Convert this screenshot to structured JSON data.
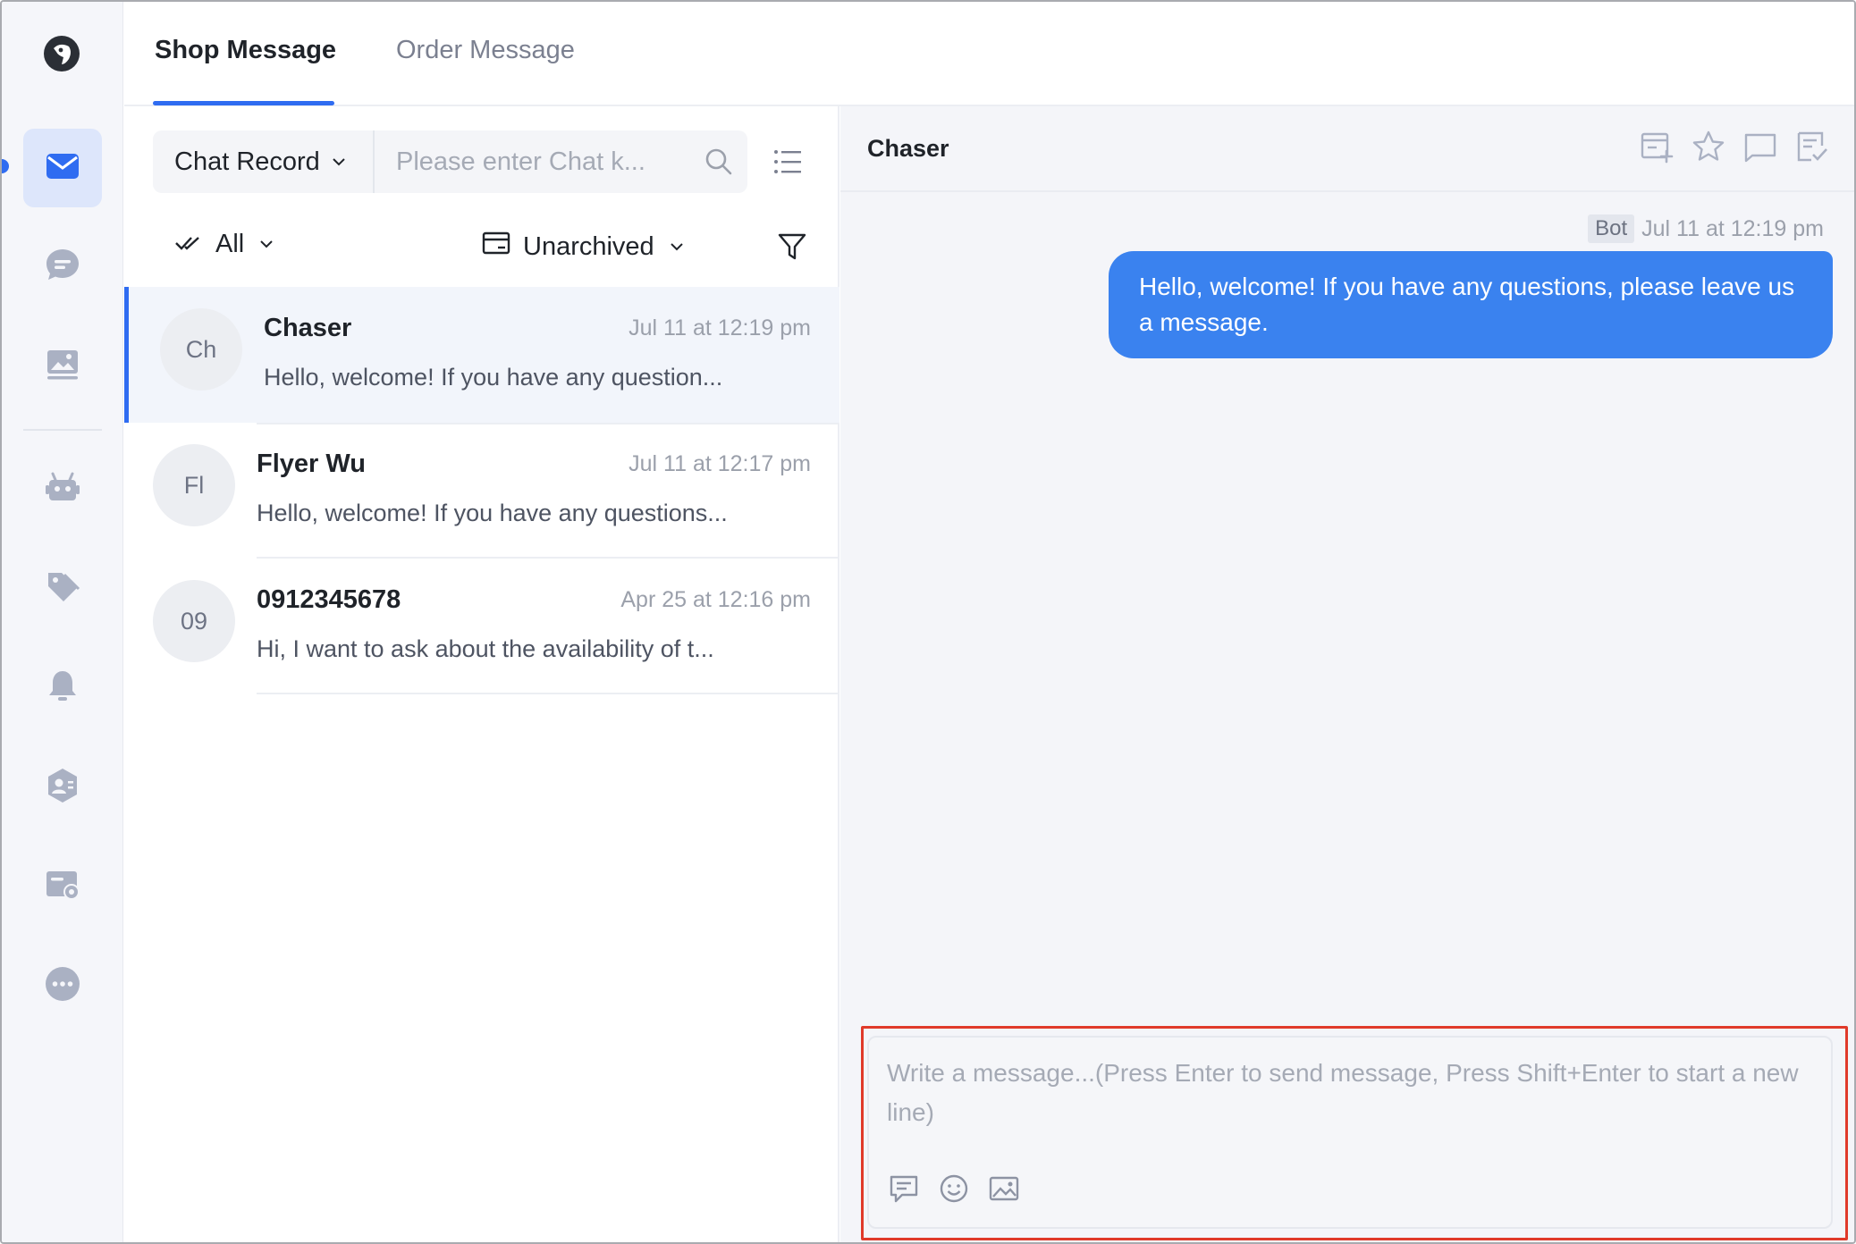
{
  "tabs": {
    "shop": "Shop Message",
    "order": "Order Message"
  },
  "search": {
    "select_label": "Chat Record",
    "placeholder": "Please enter Chat k..."
  },
  "filters": {
    "all": "All",
    "archive": "Unarchived"
  },
  "conversations": [
    {
      "initials": "Ch",
      "name": "Chaser",
      "time": "Jul 11 at 12:19 pm",
      "preview": "Hello, welcome! If you have any question..."
    },
    {
      "initials": "Fl",
      "name": "Flyer Wu",
      "time": "Jul 11 at 12:17 pm",
      "preview": "Hello, welcome! If you have any questions..."
    },
    {
      "initials": "09",
      "name": "0912345678",
      "time": "Apr 25 at 12:16 pm",
      "preview": "Hi, I want to ask about the availability of t..."
    }
  ],
  "chat": {
    "title": "Chaser",
    "messages": [
      {
        "badge": "Bot",
        "time": "Jul 11 at 12:19 pm",
        "text": "Hello, welcome! If you have any questions, please leave us a message."
      }
    ],
    "composer_placeholder": "Write a message...(Press Enter to send message, Press Shift+Enter to start a new line)"
  },
  "colors": {
    "accent": "#2f6cf1",
    "bubble": "#3a82ef",
    "highlight": "#e03a2a",
    "icon": "#aab1c3"
  },
  "icons": {
    "rail": [
      "mail-icon",
      "chat-bubble-icon",
      "image-icon",
      "robot-icon",
      "tag-icon",
      "bell-icon",
      "contact-icon",
      "ticket-settings-icon",
      "more-icon"
    ],
    "header": [
      "archive-add-icon",
      "star-icon",
      "comment-icon",
      "note-check-icon"
    ],
    "composer": [
      "quick-reply-icon",
      "emoji-icon",
      "image-icon"
    ]
  }
}
